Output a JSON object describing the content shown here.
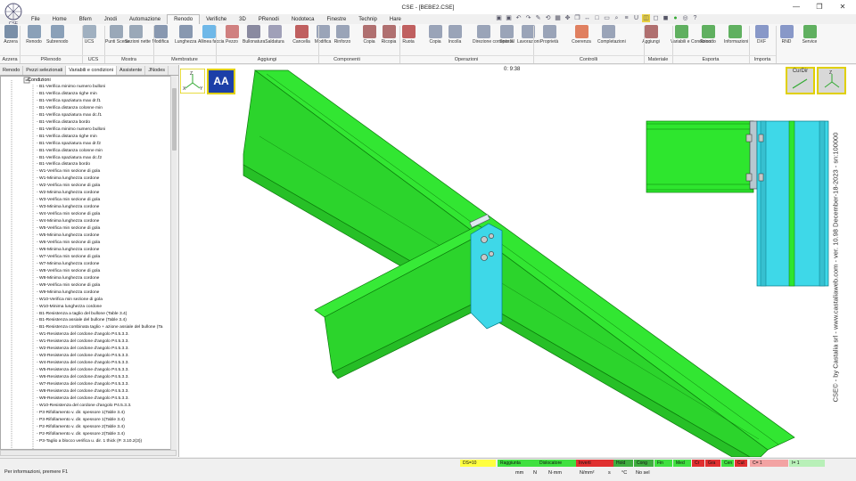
{
  "window": {
    "title": "CSE - [BEBE2.CSE]",
    "minimize": "—",
    "maximize": "❐",
    "close": "✕"
  },
  "menu": [
    "File",
    "Home",
    "Bfem",
    "Jnodi",
    "Automazione",
    "Renodo",
    "Verifiche",
    "3D",
    "PRenodi",
    "Nodoteca",
    "Finestre",
    "Technip",
    "Hare"
  ],
  "ribbon": {
    "buttons": [
      {
        "label": "Azzera",
        "color": "#7a8fa8"
      },
      {
        "label": "Renodo",
        "color": "#8aa0b8"
      },
      {
        "label": "Subrenodo",
        "color": "#8aa0b8"
      },
      {
        "label": "UCS",
        "color": "#a0b0c0"
      },
      {
        "label": "Punti Scena",
        "color": "#9aa8b8"
      },
      {
        "label": "Sezioni nette",
        "color": "#9aa8b8"
      },
      {
        "label": "Modifica",
        "color": "#8898b0"
      },
      {
        "label": "Lunghezza",
        "color": "#8898b0"
      },
      {
        "label": "Allinea faccia",
        "color": "#6fb8e8"
      },
      {
        "label": "Pezzo",
        "color": "#d08080"
      },
      {
        "label": "Bullonatura",
        "color": "#8a8aa0"
      },
      {
        "label": "Saldatura",
        "color": "#a0a0b8"
      },
      {
        "label": "Cancella",
        "color": "#c06060"
      },
      {
        "label": "Modifica",
        "color": "#9aa4b8"
      },
      {
        "label": "Rinforzo",
        "color": "#9aa4b8"
      },
      {
        "label": "Copia",
        "color": "#b07070"
      },
      {
        "label": "Ricopia",
        "color": "#b07070"
      },
      {
        "label": "Ruota",
        "color": "#c06060"
      },
      {
        "label": "Copia",
        "color": "#9aa4b8"
      },
      {
        "label": "Incolla",
        "color": "#9aa4b8"
      },
      {
        "label": "Direzione corrente Xl",
        "color": "#9aa4b8"
      },
      {
        "label": "Sposta",
        "color": "#9aa4b8"
      },
      {
        "label": "Lavorazioni",
        "color": "#9aa4b8"
      },
      {
        "label": "Proprietà",
        "color": "#9aa4b8"
      },
      {
        "label": "Coerenza",
        "color": "#e08060"
      },
      {
        "label": "Completazioni",
        "color": "#9aa4b8"
      },
      {
        "label": "Aggiungi",
        "color": "#b07070"
      },
      {
        "label": "Variabili e Condizioni",
        "color": "#60b060"
      },
      {
        "label": "Renodo",
        "color": "#60b060"
      },
      {
        "label": "Informazioni",
        "color": "#60b060"
      },
      {
        "label": "DXF",
        "color": "#8898c8"
      },
      {
        "label": "RND",
        "color": "#8898c8"
      },
      {
        "label": "Service",
        "color": "#60b060"
      }
    ],
    "groups": [
      "Azzera",
      "PRenodo",
      "UCS",
      "Mostra",
      "Membrature",
      "Aggiungi",
      "Componenti",
      "Operazioni",
      "Controlli",
      "Materiale",
      "Esporta",
      "Importa"
    ]
  },
  "panel": {
    "tabs": [
      "Renodo",
      "Pezzi selezionati",
      "Variabili e condizioni",
      "Assistente",
      "JNodes"
    ],
    "root": "Condizioni",
    "items": [
      "B1-Verifica minimo numero bulloni",
      "B1-Verifica distanza righe min",
      "B1-Verifica spaziatura max dr.f1",
      "B1-Verifica distanza colonne min",
      "B1-Verifica spaziatura max dc.f1",
      "B1-Verifica distanza bordo",
      "B1-Verifica minimo numero bulloni",
      "B1-Verifica distanza righe min",
      "B1-Verifica spaziatura max dr.f2",
      "B1-Verifica distanza colonne min",
      "B1-Verifica spaziatura max dc.f2",
      "B1-Verifica distanza bordo",
      "W1-Verifica min sezione di gola",
      "W1-Minima lunghezza cordone",
      "W2-Verifica min sezione di gola",
      "W2-Minima lunghezza cordone",
      "W3-Verifica min sezione di gola",
      "W3-Minima lunghezza cordone",
      "W4-Verifica min sezione di gola",
      "W4-Minima lunghezza cordone",
      "W5-Verifica min sezione di gola",
      "W5-Minima lunghezza cordone",
      "W6-Verifica min sezione di gola",
      "W6-Minima lunghezza cordone",
      "W7-Verifica min sezione di gola",
      "W7-Minima lunghezza cordone",
      "W8-Verifica min sezione di gola",
      "W8-Minima lunghezza cordone",
      "W9-Verifica min sezione di gola",
      "W9-Minima lunghezza cordone",
      "W10-Verifica min sezione di gola",
      "W10-Minima lunghezza cordone",
      "B1-Resistenza a taglio del bullone (Table 3.4)",
      "B1-Resistenza assiale del bullone (Table 3.4)",
      "B1-Resistenza combinata taglio + azione assiale del bullone (Ta",
      "W1-Resistenza del cordone d'angolo P4.5.3.3.",
      "W1-Resistenza del cordone d'angolo P4.5.3.3.",
      "W2-Resistenza del cordone d'angolo P4.5.3.3.",
      "W3-Resistenza del cordone d'angolo P4.5.3.3.",
      "W4-Resistenza del cordone d'angolo P4.5.3.3.",
      "W5-Resistenza del cordone d'angolo P4.5.3.3.",
      "W6-Resistenza del cordone d'angolo P4.5.3.3.",
      "W7-Resistenza del cordone d'angolo P4.5.3.3.",
      "W8-Resistenza del cordone d'angolo P4.5.3.3.",
      "W9-Resistenza del cordone d'angolo P4.5.3.3.",
      "W10-Resistenza del cordone d'angolo P4.5.3.3.",
      "P3-Rifollamento v. dir. spessore 1(Table 3.4)",
      "P3-Rifollamento v. dir. spessore 1(Table 3.4)",
      "P2-Rifollamento v. dir. spessore 2(Table 3.4)",
      "P2-Rifollamento v. dir. spessore 2(Table 3.4)",
      "P3-Taglio a blocco verifica u. dir. 1 thick (P. 3.10.2(3))"
    ]
  },
  "viewport": {
    "coord": "0: 9:38",
    "aa_label": "AA",
    "curdir_label": "CurDir",
    "side_text": "CSE© - by Castalia srl - www.castaliaweb.com - ver. 10.98 December-18-2023 - sn:100000",
    "axis": {
      "z": "Z",
      "x": "X",
      "y": "Y"
    },
    "beam_color": "#2ee62e",
    "plate_color": "#3ed8e8"
  },
  "status": {
    "message": "Per informazioni, premere F1",
    "indicators": [
      {
        "label": "DS=10",
        "bg": "#ffff40"
      },
      {
        "label": "Raggiunta",
        "bg": "#40e040"
      },
      {
        "label": "Dislocatore",
        "bg": "#40e040"
      },
      {
        "label": "Inverti",
        "bg": "#e03030"
      },
      {
        "label": "Hold",
        "bg": "#3fae3f"
      },
      {
        "label": "Cong",
        "bg": "#3fae3f"
      },
      {
        "label": "Fin",
        "bg": "#40e040"
      },
      {
        "label": "Med",
        "bg": "#40e040"
      },
      {
        "label": "Cr",
        "bg": "#e03030"
      },
      {
        "label": "Gra",
        "bg": "#e03030"
      },
      {
        "label": "Cen",
        "bg": "#40e040"
      },
      {
        "label": "Cut",
        "bg": "#e03030"
      },
      {
        "label": "C= 1",
        "bg": "#f3a3a3"
      },
      {
        "label": "I= 1",
        "bg": "#b8f0b8"
      }
    ],
    "units": [
      "mm",
      "N",
      "N·mm",
      "N/mm²",
      "s",
      "°C",
      "No sel"
    ]
  }
}
